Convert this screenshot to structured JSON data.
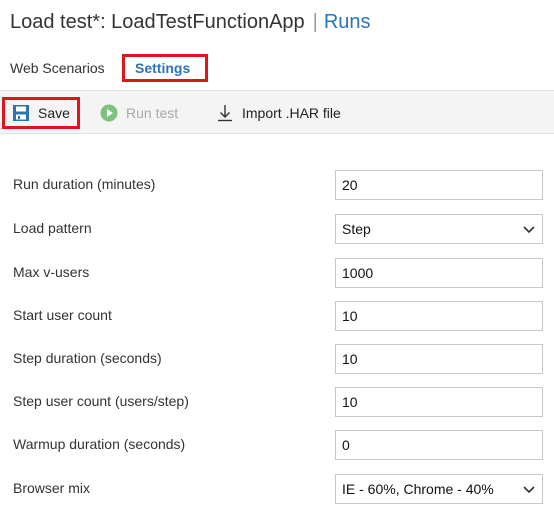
{
  "header": {
    "title": "Load test*: LoadTestFunctionApp",
    "separator": "|",
    "runs_link": "Runs"
  },
  "tabs": [
    {
      "label": "Web Scenarios"
    },
    {
      "label": "Settings"
    }
  ],
  "toolbar": {
    "save_label": "Save",
    "run_label": "Run test",
    "import_label": "Import .HAR file"
  },
  "form": {
    "run_duration": {
      "label": "Run duration (minutes)",
      "value": "20"
    },
    "load_pattern": {
      "label": "Load pattern",
      "value": "Step"
    },
    "max_vusers": {
      "label": "Max v-users",
      "value": "1000"
    },
    "start_user_count": {
      "label": "Start user count",
      "value": "10"
    },
    "step_duration": {
      "label": "Step duration (seconds)",
      "value": "10"
    },
    "step_user_count": {
      "label": "Step user count (users/step)",
      "value": "10"
    },
    "warmup_duration": {
      "label": "Warmup duration (seconds)",
      "value": "0"
    },
    "browser_mix": {
      "label": "Browser mix",
      "value": "IE - 60%, Chrome - 40%"
    }
  },
  "colors": {
    "accent": "#2a73b7",
    "highlight": "#e0141e",
    "run_icon": "#7ec17e"
  },
  "icons": {
    "save": "save-icon",
    "run": "play-icon",
    "import": "download-icon",
    "dropdown": "chevron-down-icon"
  }
}
